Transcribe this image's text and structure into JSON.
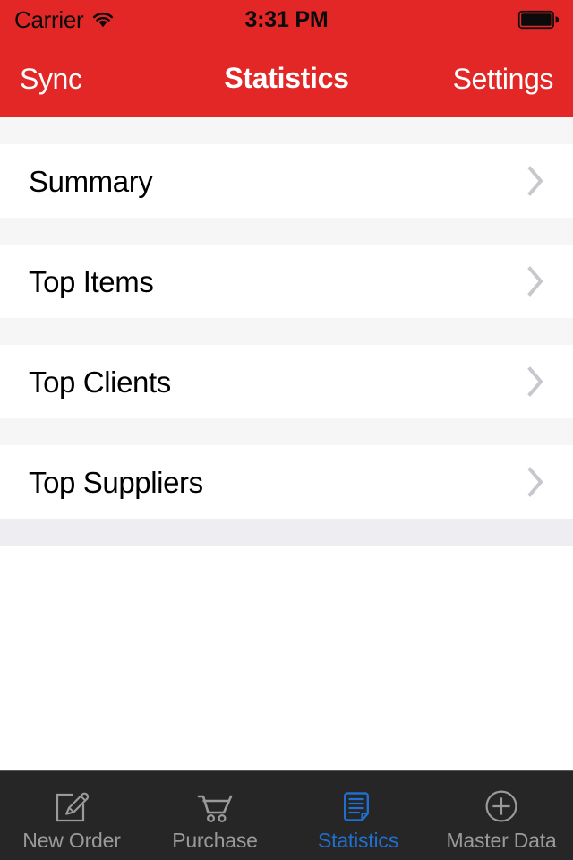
{
  "status_bar": {
    "carrier": "Carrier",
    "wifi_icon": "wifi-icon",
    "time": "3:31 PM",
    "battery_icon": "battery-full-icon"
  },
  "nav_bar": {
    "left_button": "Sync",
    "title": "Statistics",
    "right_button": "Settings",
    "background_color": "#e32626",
    "text_color": "#ffffff"
  },
  "list": {
    "disclosure_icon": "chevron-right-icon",
    "rows": [
      {
        "label": "Summary"
      },
      {
        "label": "Top Items"
      },
      {
        "label": "Top Clients"
      },
      {
        "label": "Top Suppliers"
      }
    ]
  },
  "tab_bar": {
    "background_color": "#262626",
    "active_color": "#1f6fd0",
    "inactive_color": "#9a9a9a",
    "items": [
      {
        "label": "New Order",
        "icon": "compose-pencil-square-icon",
        "active": false
      },
      {
        "label": "Purchase",
        "icon": "shopping-cart-icon",
        "active": false
      },
      {
        "label": "Statistics",
        "icon": "document-page-icon",
        "active": true
      },
      {
        "label": "Master Data",
        "icon": "plus-circle-icon",
        "active": false
      }
    ]
  }
}
